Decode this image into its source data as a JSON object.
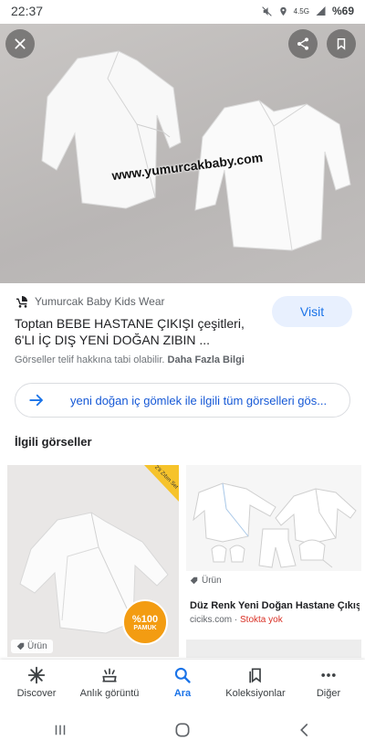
{
  "status_bar": {
    "time": "22:37",
    "network": "4.5G",
    "battery": "%69"
  },
  "image": {
    "watermark": "www.yumurcakbaby.com"
  },
  "result": {
    "source_name": "Yumurcak Baby Kids Wear",
    "title": "Toptan BEBE HASTANE ÇIKIŞI çeşitleri, 6'LI İÇ DIŞ YENİ DOĞAN ZIBIN ...",
    "visit_label": "Visit",
    "copyright_text": "Görseller telif hakkına tabi olabilir.",
    "more_info": "Daha Fazla Bilgi"
  },
  "see_all": {
    "text": "yeni doğan iç gömlek ile ilgili tüm görselleri gös..."
  },
  "related": {
    "heading": "İlgili görseller",
    "card1": {
      "badge": "Ürün",
      "ribbon": "2'li Zıbın Set",
      "pamuk_percent": "%100",
      "pamuk_label": "PAMUK"
    },
    "card2": {
      "badge": "Ürün",
      "title": "Düz Renk Yeni Doğan Hastane Çıkışı İç...",
      "source": "ciciks.com",
      "separator": " · ",
      "stock": "Stokta yok"
    }
  },
  "bottom_nav": [
    {
      "label": "Discover",
      "icon": "asterisk-icon"
    },
    {
      "label": "Anlık görüntü",
      "icon": "snapshot-icon"
    },
    {
      "label": "Ara",
      "icon": "search-icon"
    },
    {
      "label": "Koleksiyonlar",
      "icon": "collections-icon"
    },
    {
      "label": "Diğer",
      "icon": "more-icon"
    }
  ],
  "colors": {
    "accent": "#1a73e8",
    "visit_bg": "#e8f0fe",
    "stock_red": "#d93025",
    "pamuk_orange": "#f39c12"
  }
}
